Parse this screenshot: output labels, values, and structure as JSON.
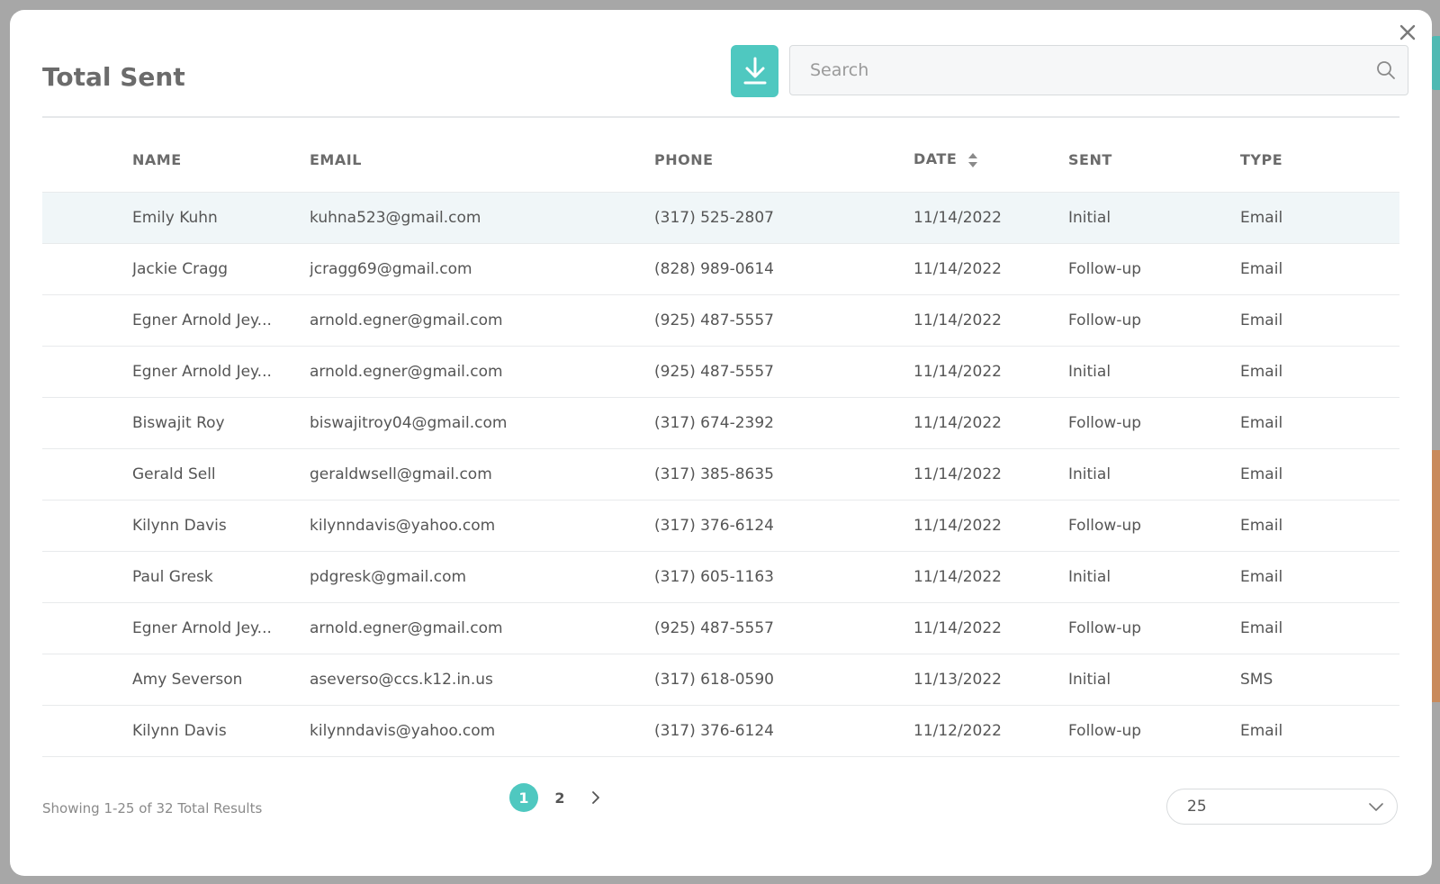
{
  "modal": {
    "title": "Total Sent",
    "close_label": "X"
  },
  "icons": {
    "download": "download-icon",
    "search": "search-icon",
    "sort": "sort-icon",
    "next": "chevron-right-icon",
    "dropdown": "chevron-down-icon"
  },
  "colors": {
    "accent": "#4fc8c0",
    "highlight_row": "#f0f6f8"
  },
  "search": {
    "placeholder": "Search",
    "value": ""
  },
  "table": {
    "headers": {
      "name": "NAME",
      "email": "EMAIL",
      "phone": "PHONE",
      "date": "DATE",
      "sent": "SENT",
      "type": "TYPE"
    },
    "rows": [
      {
        "name": "Emily Kuhn",
        "email": "kuhna523@gmail.com",
        "phone": "(317) 525-2807",
        "date": "11/14/2022",
        "sent": "Initial",
        "type": "Email"
      },
      {
        "name": "Jackie Cragg",
        "email": "jcragg69@gmail.com",
        "phone": "(828) 989-0614",
        "date": "11/14/2022",
        "sent": "Follow-up",
        "type": "Email"
      },
      {
        "name": "Egner Arnold Jey...",
        "email": "arnold.egner@gmail.com",
        "phone": "(925) 487-5557",
        "date": "11/14/2022",
        "sent": "Follow-up",
        "type": "Email"
      },
      {
        "name": "Egner Arnold Jey...",
        "email": "arnold.egner@gmail.com",
        "phone": "(925) 487-5557",
        "date": "11/14/2022",
        "sent": "Initial",
        "type": "Email"
      },
      {
        "name": "Biswajit Roy",
        "email": "biswajitroy04@gmail.com",
        "phone": "(317) 674-2392",
        "date": "11/14/2022",
        "sent": "Follow-up",
        "type": "Email"
      },
      {
        "name": "Gerald Sell",
        "email": "geraldwsell@gmail.com",
        "phone": "(317) 385-8635",
        "date": "11/14/2022",
        "sent": "Initial",
        "type": "Email"
      },
      {
        "name": "Kilynn Davis",
        "email": "kilynndavis@yahoo.com",
        "phone": "(317) 376-6124",
        "date": "11/14/2022",
        "sent": "Follow-up",
        "type": "Email"
      },
      {
        "name": "Paul Gresk",
        "email": "pdgresk@gmail.com",
        "phone": "(317) 605-1163",
        "date": "11/14/2022",
        "sent": "Initial",
        "type": "Email"
      },
      {
        "name": "Egner Arnold Jey...",
        "email": "arnold.egner@gmail.com",
        "phone": "(925) 487-5557",
        "date": "11/14/2022",
        "sent": "Follow-up",
        "type": "Email"
      },
      {
        "name": "Amy Severson",
        "email": "aseverso@ccs.k12.in.us",
        "phone": "(317) 618-0590",
        "date": "11/13/2022",
        "sent": "Initial",
        "type": "SMS"
      },
      {
        "name": "Kilynn Davis",
        "email": "kilynndavis@yahoo.com",
        "phone": "(317) 376-6124",
        "date": "11/12/2022",
        "sent": "Follow-up",
        "type": "Email"
      }
    ]
  },
  "footer": {
    "results_text": "Showing 1-25 of 32 Total Results",
    "pages": [
      "1",
      "2"
    ],
    "current_page": "1",
    "page_size": "25"
  }
}
